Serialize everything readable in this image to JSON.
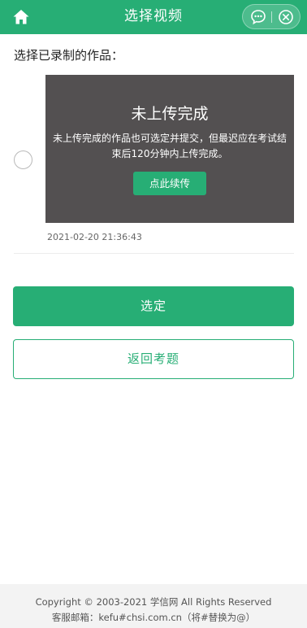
{
  "header": {
    "title": "选择视频",
    "home_icon": "home-icon",
    "more_icon": "more-dots-icon",
    "close_icon": "close-circle-icon",
    "bg_color": "#27ae75"
  },
  "main": {
    "section_label": "选择已录制的作品：",
    "video": {
      "status_title": "未上传完成",
      "status_desc": "未上传完成的作品也可选定并提交，但最迟应在考试结束后120分钟内上传完成。",
      "resume_label": "点此续传",
      "timestamp": "2021-02-20 21:36:43",
      "selected": false
    }
  },
  "actions": {
    "select_label": "选定",
    "back_label": "返回考题",
    "accent_color": "#27ae75"
  },
  "footer": {
    "copyright": "Copyright © 2003-2021 学信网 All Rights Reserved",
    "contact": "客服邮箱：kefu#chsi.com.cn（将#替换为@）"
  }
}
